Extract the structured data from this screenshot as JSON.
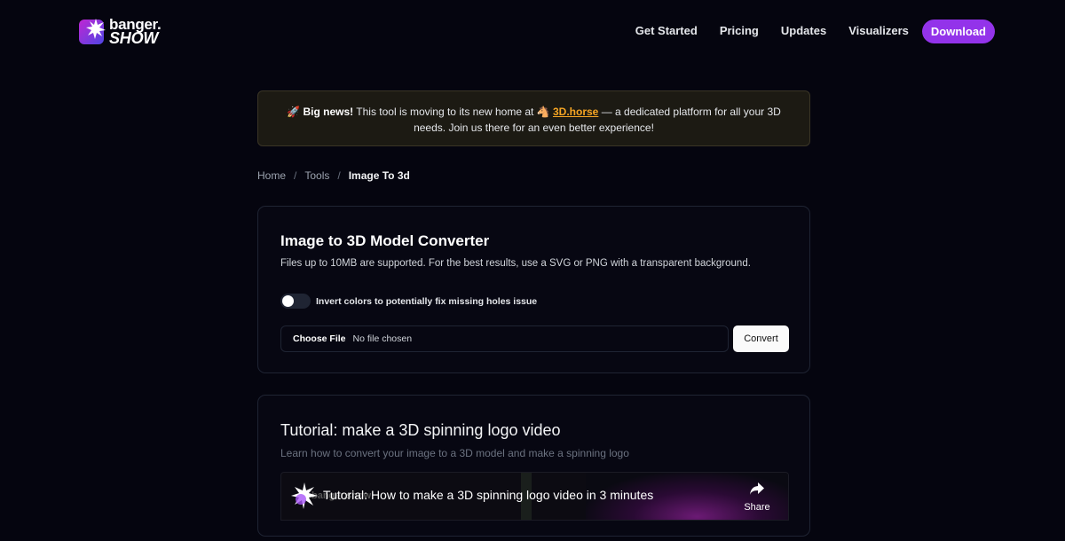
{
  "brand": {
    "line1": "banger.",
    "line2": "SHOW",
    "colors": {
      "accent": "#9333ea",
      "background": "#05050f",
      "banner_link": "#f5a524"
    }
  },
  "nav": {
    "links": [
      "Get Started",
      "Pricing",
      "Updates",
      "Visualizers"
    ],
    "download_label": "Download"
  },
  "banner": {
    "icon": "rocket-icon",
    "strong": "Big news!",
    "text_before_link": " This tool is moving to its new home at ",
    "link_icon": "horse-icon",
    "link_text": "3D.horse",
    "text_after_link": " — a dedicated platform for all your 3D needs. Join us there for an even better experience!"
  },
  "breadcrumb": {
    "home": "Home",
    "tools": "Tools",
    "current": "Image To 3d",
    "separator": "/"
  },
  "converter": {
    "title": "Image to 3D Model Converter",
    "description": "Files up to 10MB are supported. For the best results, use a SVG or PNG with a transparent background.",
    "invert_label": "Invert colors to potentially fix missing holes issue",
    "invert_on": false,
    "choose_file_label": "Choose File",
    "file_status": "No file chosen",
    "convert_label": "Convert"
  },
  "tutorial": {
    "title": "Tutorial: make a 3D spinning logo video",
    "description": "Learn how to convert your image to a 3D model and make a spinning logo",
    "video_title": "Tutorial: How to make a 3D spinning logo video in 3 minutes",
    "video_channel_text": "banger.show",
    "share_label": "Share"
  }
}
